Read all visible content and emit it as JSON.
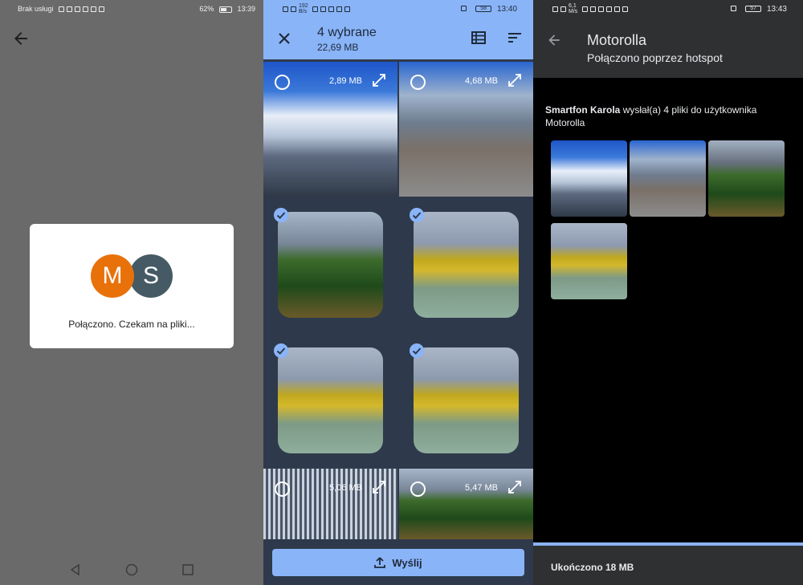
{
  "screen1": {
    "status": {
      "carrier": "Brak usługi",
      "battery": "62%",
      "battery_level": 0.62,
      "time": "13:39"
    },
    "back_icon": "arrow-left-icon",
    "avatar_m": "M",
    "avatar_s": "S",
    "message": "Połączono. Czekam na pliki...",
    "avatar_colors": {
      "m": "#e8710a",
      "s": "#455a64"
    }
  },
  "screen2": {
    "status": {
      "network_speed": "192 B/s",
      "battery": "58",
      "battery_level": 0.58,
      "time": "13:40"
    },
    "title": "4 wybrane",
    "subtitle": "22,69 MB",
    "tiles": [
      {
        "size": "2,89 MB",
        "selected": false,
        "photo": "sky"
      },
      {
        "size": "4,68 MB",
        "selected": false,
        "photo": "street"
      },
      {
        "size": "",
        "selected": true,
        "photo": "tree"
      },
      {
        "size": "",
        "selected": true,
        "photo": "yellow"
      },
      {
        "size": "",
        "selected": true,
        "photo": "yellow"
      },
      {
        "size": "",
        "selected": true,
        "photo": "yellow"
      },
      {
        "size": "5,06 MB",
        "selected": false,
        "photo": "bldg"
      },
      {
        "size": "5,47 MB",
        "selected": false,
        "photo": "tree"
      }
    ],
    "send_label": "Wyślij",
    "accent": "#8ab4f8"
  },
  "screen3": {
    "status": {
      "network_speed": "6,1 M/s",
      "battery": "57",
      "battery_level": 0.57,
      "time": "13:43"
    },
    "title": "Motorolla",
    "subtitle": "Połączono poprzez hotspot",
    "sender": "Smartfon Karola",
    "message_rest": " wysłał(a) 4 pliki do użytkownika Motorolla",
    "thumbs": [
      "sky",
      "street",
      "tree",
      "yellow"
    ],
    "done": "Ukończono 18 MB"
  }
}
